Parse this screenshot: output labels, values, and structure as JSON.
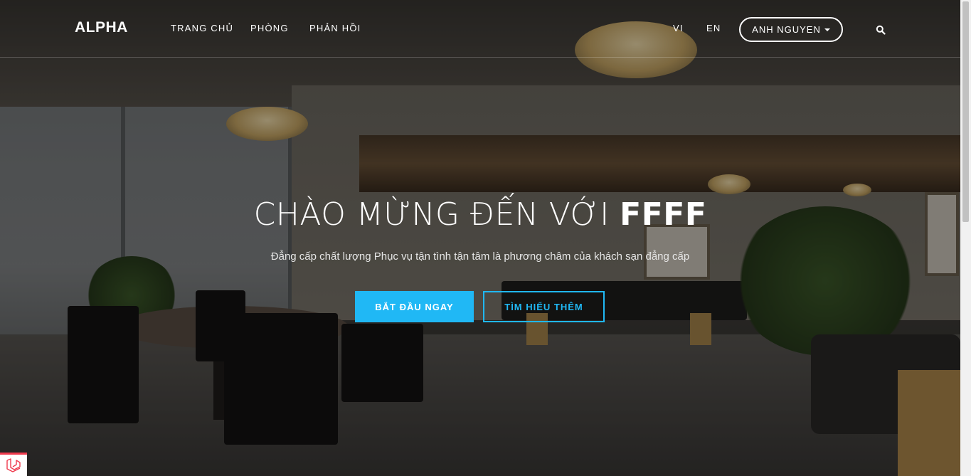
{
  "navbar": {
    "brand": "ALPHA",
    "links": [
      {
        "label": "TRANG CHỦ"
      },
      {
        "label": "PHÒNG"
      },
      {
        "label": "PHẢN HỒI"
      }
    ],
    "languages": [
      {
        "label": "VI"
      },
      {
        "label": "EN"
      }
    ],
    "user": {
      "label": "ANH NGUYEN",
      "icon": "caret-down-icon"
    },
    "search_icon": "search-icon"
  },
  "hero": {
    "title_prefix": "CHÀO MỪNG ĐẾN VỚI ",
    "title_highlight": "FFFF",
    "subtitle": "Đẳng cấp chất lượng Phục vụ tận tình tận tâm là phương châm của khách sạn đẳng cấp",
    "primary_button": "BẮT ĐẦU NGAY",
    "secondary_button": "TÌM HIỂU THÊM"
  },
  "colors": {
    "accent": "#20b8f5",
    "overlay": "rgba(0,0,0,0.38)",
    "badge_accent": "#ef3b4e"
  },
  "debug_badge": {
    "icon": "laravel-logo-icon"
  }
}
